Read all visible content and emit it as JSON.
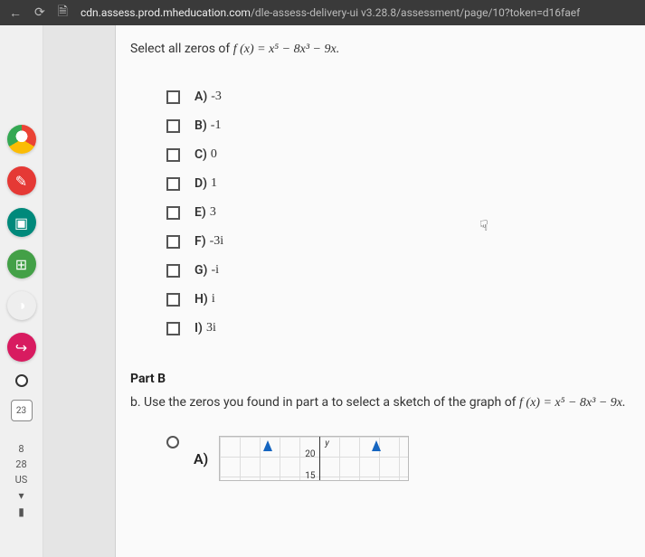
{
  "browser": {
    "url_prefix": "cdn.assess.prod.mheducation.com",
    "url_suffix": "/dle-assess-delivery-ui v3.28.8/assessment/page/10?token=d16faef"
  },
  "taskbar": {
    "square_label": "23",
    "num_top": "8",
    "num_mid": "28",
    "locale": "US"
  },
  "question": {
    "prompt_prefix": "Select all zeros of ",
    "function_lhs": "f (x) = ",
    "function_rhs": "x⁵ − 8x³ − 9x.",
    "options": [
      {
        "label": "A)",
        "value": "-3"
      },
      {
        "label": "B)",
        "value": "-1"
      },
      {
        "label": "C)",
        "value": "0"
      },
      {
        "label": "D)",
        "value": "1"
      },
      {
        "label": "E)",
        "value": "3"
      },
      {
        "label": "F)",
        "value": "-3i"
      },
      {
        "label": "G)",
        "value": "-i"
      },
      {
        "label": "H)",
        "value": "i"
      },
      {
        "label": "I)",
        "value": "3i"
      }
    ]
  },
  "partB": {
    "title": "Part B",
    "prefix": "b. ",
    "text_before": "Use the zeros you found in part a to select a sketch of the graph of ",
    "function_lhs": "f (x) = ",
    "function_rhs": "x⁵ − 8x³ − 9x.",
    "option_label": "A)",
    "graph": {
      "y_label": "y",
      "tick1": "20",
      "tick2": "15"
    }
  }
}
